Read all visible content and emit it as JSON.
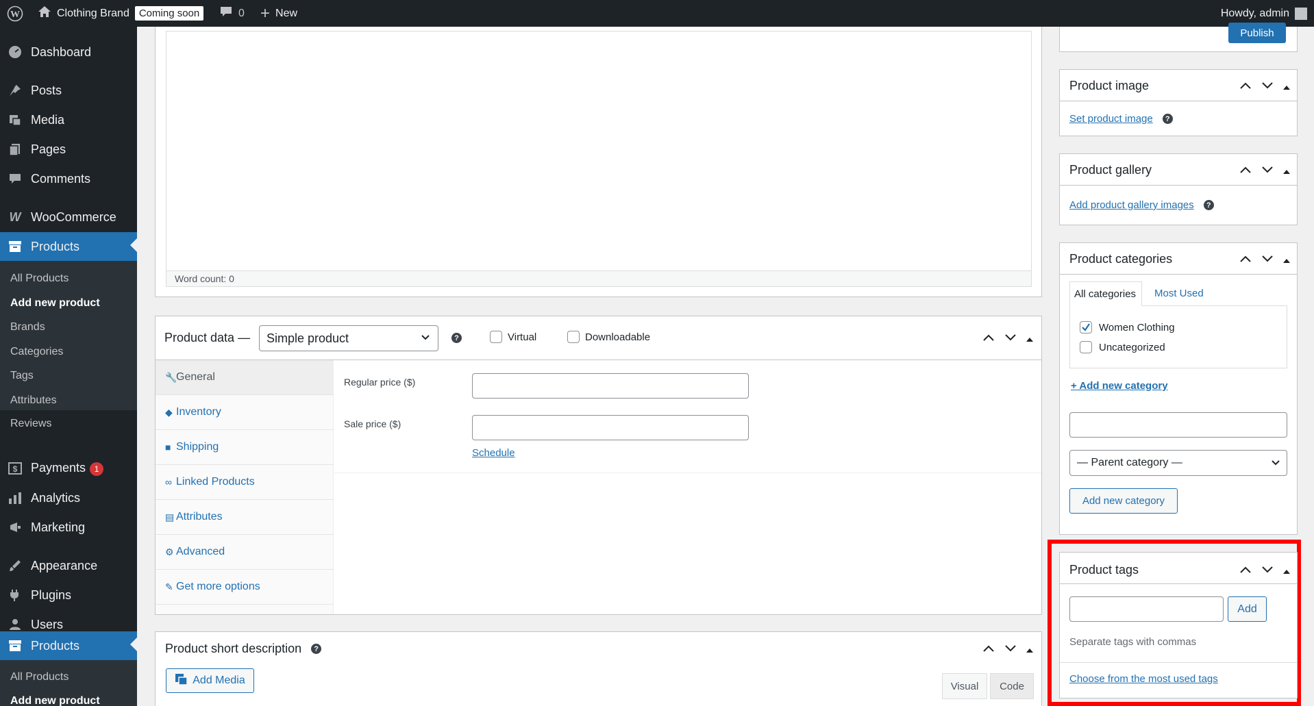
{
  "adminbar": {
    "site_name": "Clothing Brand",
    "coming_soon": "Coming soon",
    "comments_count": "0",
    "new_label": "New",
    "howdy": "Howdy, admin"
  },
  "sidebar": {
    "dashboard": "Dashboard",
    "posts": "Posts",
    "media": "Media",
    "pages": "Pages",
    "comments": "Comments",
    "woocommerce": "WooCommerce",
    "products": "Products",
    "products_sub": [
      "All Products",
      "Add new product",
      "Brands",
      "Categories",
      "Tags",
      "Attributes",
      "Reviews"
    ],
    "payments": "Payments",
    "payments_badge": "1",
    "analytics": "Analytics",
    "marketing": "Marketing",
    "appearance": "Appearance",
    "plugins": "Plugins",
    "users": "Users",
    "products2": "Products",
    "products2_sub": [
      "All Products",
      "Add new product"
    ]
  },
  "editor": {
    "word_count": "Word count: 0"
  },
  "product_data": {
    "title": "Product data —",
    "type_value": "Simple product",
    "virtual_label": "Virtual",
    "downloadable_label": "Downloadable",
    "tabs": [
      "General",
      "Inventory",
      "Shipping",
      "Linked Products",
      "Attributes",
      "Advanced",
      "Get more options"
    ],
    "regular_price_label": "Regular price ($)",
    "sale_price_label": "Sale price ($)",
    "schedule_link": "Schedule"
  },
  "short_description": {
    "title": "Product short description",
    "add_media": "Add Media",
    "visual_tab": "Visual",
    "code_tab": "Code"
  },
  "publish": {
    "button": "Publish"
  },
  "product_image": {
    "title": "Product image",
    "link": "Set product image"
  },
  "product_gallery": {
    "title": "Product gallery",
    "link": "Add product gallery images"
  },
  "product_categories": {
    "title": "Product categories",
    "tab_all": "All categories",
    "tab_most_used": "Most Used",
    "items": [
      {
        "label": "Women Clothing",
        "checked": true
      },
      {
        "label": "Uncategorized",
        "checked": false
      }
    ],
    "add_new_link": "+ Add new category",
    "parent_select": "— Parent category —",
    "add_button": "Add new category"
  },
  "product_tags": {
    "title": "Product tags",
    "add_button": "Add",
    "hint": "Separate tags with commas",
    "most_used_link": "Choose from the most used tags"
  },
  "colors": {
    "accent": "#2271b1",
    "highlight_border": "#ff0000",
    "sidebar_bg": "#1d2327"
  }
}
